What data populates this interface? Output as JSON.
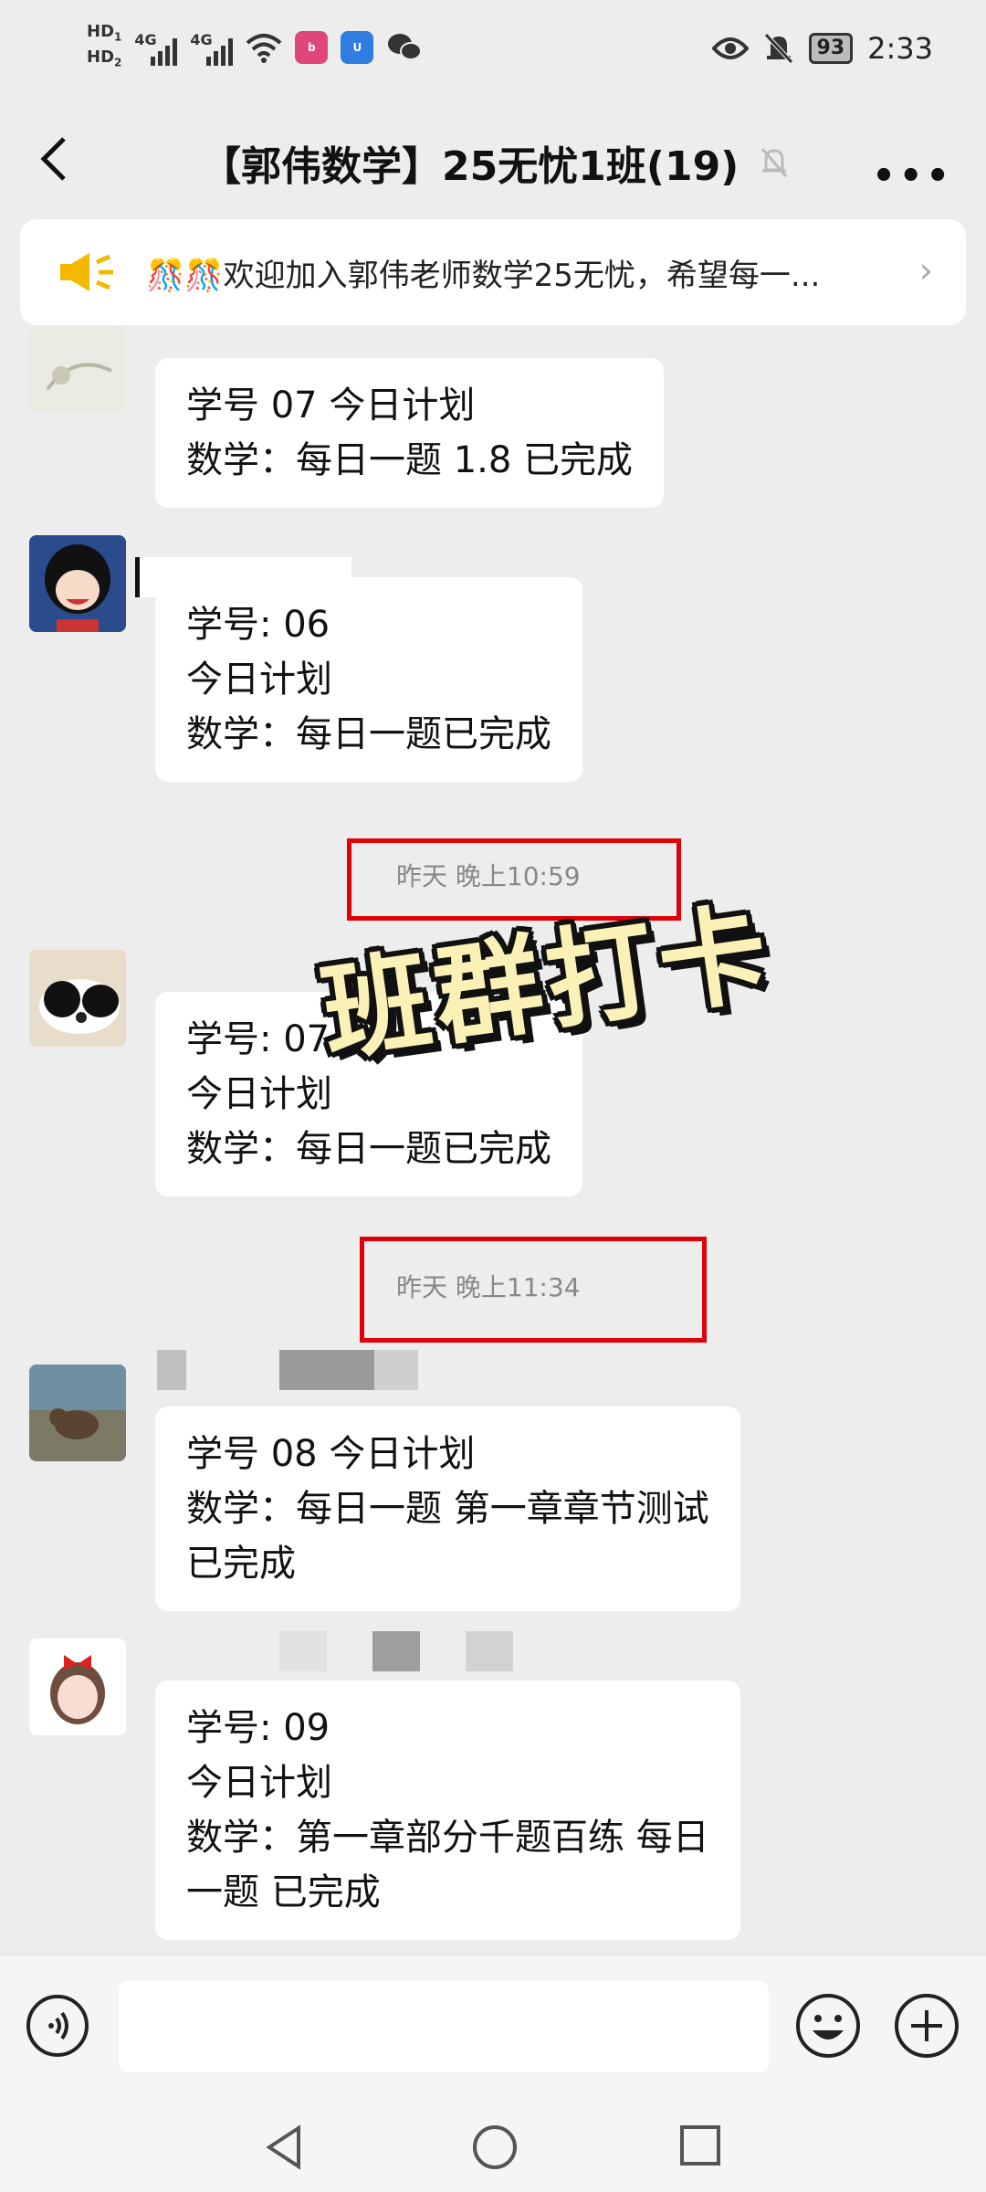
{
  "status_bar": {
    "hd1": "HD",
    "hd1_sub": "1",
    "hd2": "HD",
    "hd2_sub": "2",
    "net1": "4G",
    "net2": "4G",
    "battery": "93",
    "time": "2:33"
  },
  "header": {
    "title": "【郭伟数学】25无忧1班(19)"
  },
  "notice": {
    "text": "🎊🎊欢迎加入郭伟老师数学25无忧，希望每一..."
  },
  "messages": [
    {
      "lines": [
        "学号 07 今日计划",
        "数学：每日一题 1.8 已完成"
      ]
    },
    {
      "lines": [
        "学号: 06",
        "今日计划",
        "数学：每日一题已完成"
      ]
    },
    {
      "lines": [
        "学号: 07",
        "今日计划",
        "数学：每日一题已完成"
      ]
    },
    {
      "lines": [
        "学号 08 今日计划",
        "数学：每日一题 第一章章节测试",
        "已完成"
      ]
    },
    {
      "lines": [
        "学号: 09",
        "今日计划",
        "数学：第一章部分千题百练  每日",
        "一题  已完成"
      ]
    }
  ],
  "timestamps": [
    "昨天 晚上10:59",
    "昨天 晚上11:34"
  ],
  "overlay_text": "班群打卡",
  "colors": {
    "highlight_red": "#e0000a",
    "background": "#ededed",
    "bubble": "#ffffff"
  }
}
